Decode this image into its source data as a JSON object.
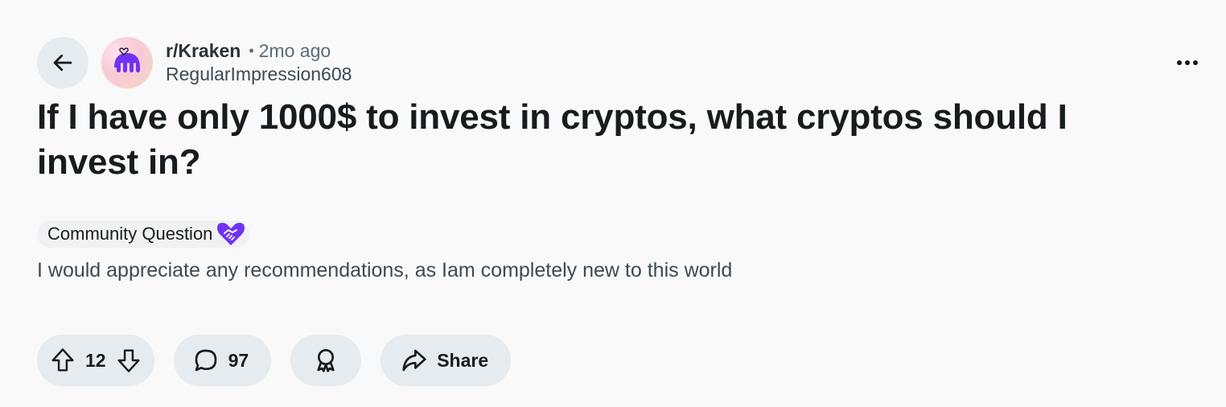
{
  "post": {
    "subreddit": "r/Kraken",
    "separator": "•",
    "time_ago": "2mo ago",
    "author": "RegularImpression608",
    "title": "If I have only 1000$ to invest in cryptos, what cryptos should I invest in?",
    "flair": "Community Question",
    "body": "I would appreciate any recommendations, as Iam completely new to this world"
  },
  "actions": {
    "vote_count": "12",
    "comment_count": "97",
    "share_label": "Share"
  },
  "icons": {
    "back": "arrow-left-icon",
    "avatar": "kraken-logo",
    "overflow": "more-horizontal-icon",
    "flair_emoji": "handshake-heart-icon",
    "upvote": "arrow-up-icon",
    "downvote": "arrow-down-icon",
    "comment": "speech-bubble-icon",
    "award": "award-icon",
    "share": "share-arrow-icon"
  },
  "colors": {
    "background": "#f9f9fa",
    "pill_background": "#e5ebee",
    "kraken_purple": "#7132f5",
    "text_primary": "#181c1f",
    "text_secondary": "#5c6c74"
  }
}
